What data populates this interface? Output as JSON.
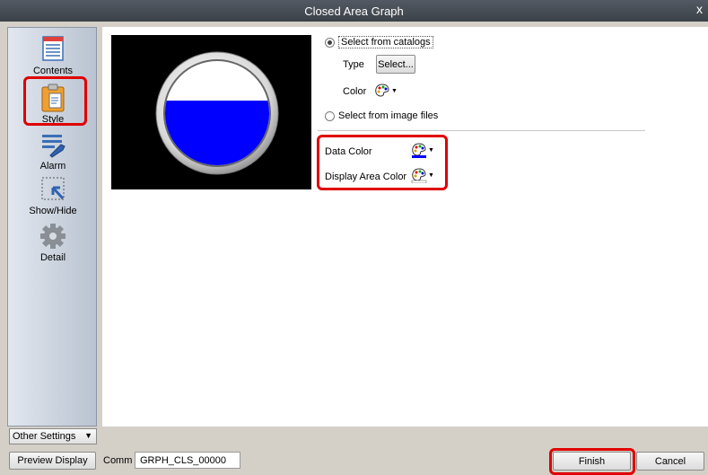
{
  "window": {
    "title": "Closed Area Graph",
    "close_glyph": "x"
  },
  "sidebar": {
    "items": [
      {
        "label": "Contents",
        "icon": "contents-icon"
      },
      {
        "label": "Style",
        "icon": "style-icon",
        "selected": true
      },
      {
        "label": "Alarm",
        "icon": "alarm-icon"
      },
      {
        "label": "Show/Hide",
        "icon": "show-hide-icon"
      },
      {
        "label": "Detail",
        "icon": "detail-icon"
      }
    ]
  },
  "style": {
    "select_from_catalogs": "Select from catalogs",
    "type_label": "Type",
    "select_button": "Select...",
    "color_label": "Color",
    "select_from_image_files": "Select from image files",
    "data_color_label": "Data Color",
    "display_area_color_label": "Display Area Color",
    "selected_source": "catalogs"
  },
  "preview": {
    "fill_color": "#0000ff",
    "empty_color": "#ffffff",
    "fill_level": 0.62
  },
  "footer": {
    "other_settings": "Other Settings",
    "preview_display": "Preview Display",
    "comm_label": "Comm",
    "comm_value": "GRPH_CLS_00000",
    "finish": "Finish",
    "cancel": "Cancel"
  },
  "colors": {
    "highlight": "#e00000",
    "title_bar": "#4a4f57"
  }
}
